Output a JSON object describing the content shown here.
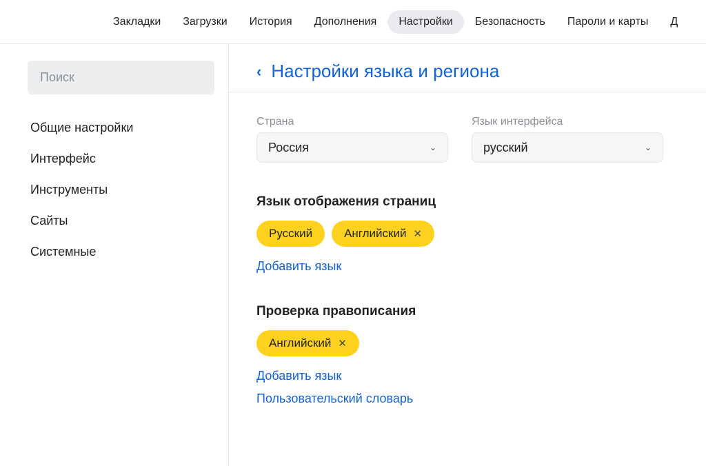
{
  "tabs": {
    "bookmarks": "Закладки",
    "downloads": "Загрузки",
    "history": "История",
    "addons": "Дополнения",
    "settings": "Настройки",
    "security": "Безопасность",
    "passwords": "Пароли и карты",
    "overflow": "Д"
  },
  "sidebar": {
    "search_placeholder": "Поиск",
    "items": [
      "Общие настройки",
      "Интерфейс",
      "Инструменты",
      "Сайты",
      "Системные"
    ]
  },
  "page": {
    "title": "Настройки языка и региона",
    "country_label": "Страна",
    "country_value": "Россия",
    "ui_lang_label": "Язык интерфейса",
    "ui_lang_value": "русский",
    "display_section": {
      "title": "Язык отображения страниц",
      "pills": [
        "Русский",
        "Английский"
      ],
      "add_link": "Добавить язык"
    },
    "spell_section": {
      "title": "Проверка правописания",
      "pills": [
        "Английский"
      ],
      "add_link": "Добавить язык",
      "dict_link": "Пользовательский словарь"
    }
  }
}
